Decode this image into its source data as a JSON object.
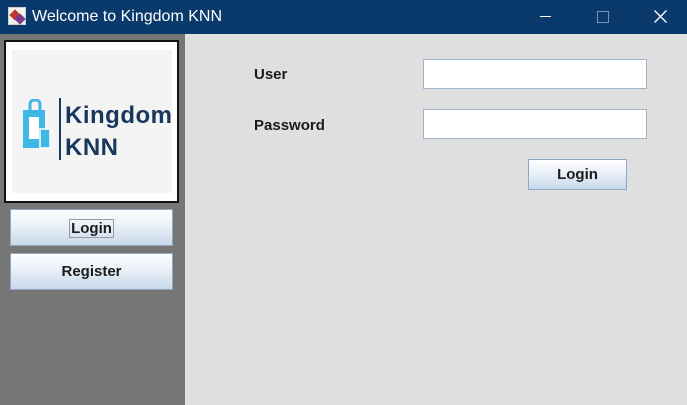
{
  "window": {
    "title": "Welcome to Kingdom KNN",
    "app_icon": "java-app-icon",
    "controls": [
      "minimize-icon",
      "maximize-icon",
      "close-icon"
    ]
  },
  "sidebar": {
    "logo": {
      "line1": "Kingdom",
      "line2": "KNN",
      "icon": "shopping-bag-icon",
      "brand_color": "#17375e",
      "icon_color": "#3fb8e6"
    },
    "buttons": [
      {
        "label": "Login",
        "focused": true
      },
      {
        "label": "Register",
        "focused": false
      }
    ]
  },
  "form": {
    "user_label": "User",
    "user_value": "",
    "password_label": "Password",
    "password_value": "",
    "login_button": "Login"
  },
  "colors": {
    "titlebar": "#0a3a6b",
    "sidebar": "#767676",
    "content": "#dfdfdf"
  }
}
